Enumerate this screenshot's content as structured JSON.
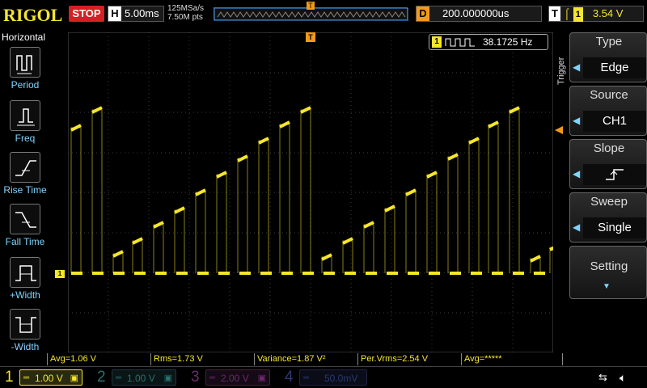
{
  "header": {
    "logo": "RIGOL",
    "run_state": "STOP",
    "timebase_label": "H",
    "timebase": "5.00ms",
    "sample_rate": "125MSa/s",
    "memory_depth": "7.50M pts",
    "memory_marker": "T",
    "delay_label": "D",
    "delay": "200.000000us",
    "trigger_label": "T",
    "trigger_channel": "1",
    "trigger_level": "3.54 V"
  },
  "left_menu": {
    "title": "Horizontal",
    "items": [
      {
        "label": "Period",
        "icon": "period-icon"
      },
      {
        "label": "Freq",
        "icon": "frequency-icon"
      },
      {
        "label": "Rise Time",
        "icon": "rise-time-icon"
      },
      {
        "label": "Fall Time",
        "icon": "fall-time-icon"
      },
      {
        "label": "+Width",
        "icon": "positive-width-icon"
      },
      {
        "label": "-Width",
        "icon": "negative-width-icon"
      }
    ]
  },
  "display": {
    "freq_channel": "1",
    "freq_value": "38.1725 Hz",
    "ch1_marker": "1",
    "trigger_pos_marker": "T"
  },
  "right_menu": {
    "panel_label": "Trigger",
    "items": [
      {
        "title": "Type",
        "value": "Edge"
      },
      {
        "title": "Source",
        "value": "CH1"
      },
      {
        "title": "Slope",
        "value": ""
      },
      {
        "title": "Sweep",
        "value": "Single"
      },
      {
        "title": "Setting",
        "value": ""
      }
    ]
  },
  "measurements": [
    {
      "text": "Avg=1.06 V"
    },
    {
      "text": "Rms=1.73 V"
    },
    {
      "text": "Variance=1.87 V²"
    },
    {
      "text": "Per.Vrms=2.54 V"
    },
    {
      "text": "Avg=*****"
    }
  ],
  "channels": [
    {
      "num": "1",
      "scale": "1.00 V",
      "active": true
    },
    {
      "num": "2",
      "scale": "1.00 V",
      "active": false
    },
    {
      "num": "3",
      "scale": "2.00 V",
      "active": false
    },
    {
      "num": "4",
      "scale": "50.0mV",
      "active": false
    }
  ],
  "colors": {
    "ch1": "#f5e62c",
    "ch2": "#00a8a8",
    "ch3": "#c832c8",
    "ch4": "#2860ff",
    "accent": "#7fd4ff",
    "stop": "#d42020",
    "delay": "#f29a18"
  }
}
